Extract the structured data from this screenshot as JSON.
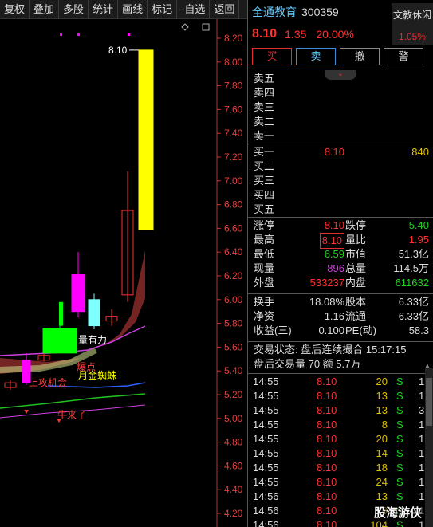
{
  "toolbar": {
    "items": [
      "复权",
      "叠加",
      "多股",
      "统计",
      "画线",
      "标记",
      "-自选",
      "返回"
    ]
  },
  "chart": {
    "axis_ticks": [
      "8.20",
      "8.00",
      "7.80",
      "7.60",
      "7.40",
      "7.20",
      "7.00",
      "6.80",
      "6.60",
      "6.40",
      "6.20",
      "6.00",
      "5.80",
      "5.60",
      "5.40",
      "5.20",
      "5.00",
      "4.80",
      "4.60",
      "4.40",
      "4.20"
    ],
    "price_label": "8.10",
    "annotations": [
      "量有力",
      "爆点",
      "月金蜘蛛",
      "上攻机会",
      "牛来了"
    ],
    "colors": {
      "up_yellow": "#ffff00",
      "magenta": "#ff00ff",
      "green": "#00ff00",
      "cyan": "#80ffff",
      "red": "#ff3030"
    },
    "icons": [
      "diamond-icon",
      "square-icon"
    ]
  },
  "header": {
    "name": "全通教育",
    "code": "300359",
    "status": "文教休闲",
    "status_pct": "1.05%"
  },
  "quote": {
    "price": "8.10",
    "change": "1.35",
    "pct": "20.00%"
  },
  "buttons": [
    "买",
    "卖",
    "撤",
    "警"
  ],
  "asks": [
    "卖五",
    "卖四",
    "卖三",
    "卖二",
    "卖一"
  ],
  "bids": [
    {
      "label": "买一",
      "price": "8.10",
      "vol": "840"
    },
    {
      "label": "买二",
      "price": "",
      "vol": ""
    },
    {
      "label": "买三",
      "price": "",
      "vol": ""
    },
    {
      "label": "买四",
      "price": "",
      "vol": ""
    },
    {
      "label": "买五",
      "price": "",
      "vol": ""
    }
  ],
  "stats1": [
    {
      "l1": "涨停",
      "v1": "8.10",
      "l2": "跌停",
      "v2": "5.40"
    },
    {
      "l1": "最高",
      "v1": "8.10",
      "l2": "量比",
      "v2": "1.95"
    },
    {
      "l1": "最低",
      "v1": "6.59",
      "l2": "市值",
      "v2": "51.3亿"
    },
    {
      "l1": "现量",
      "v1": "896",
      "l2": "总量",
      "v2": "114.5万"
    },
    {
      "l1": "外盘",
      "v1": "533237",
      "l2": "内盘",
      "v2": "611632"
    }
  ],
  "stats2": [
    {
      "l1": "换手",
      "v1": "18.08%",
      "l2": "股本",
      "v2": "6.33亿"
    },
    {
      "l1": "净资",
      "v1": "1.16",
      "l2": "流通",
      "v2": "6.33亿"
    },
    {
      "l1": "收益(三)",
      "v1": "0.100",
      "l2": "PE(动)",
      "v2": "58.3"
    }
  ],
  "trade_status": "交易状态: 盘后连续撮合 15:17:15",
  "after_hours": "盘后交易量 70 额 5.7万",
  "ticks": [
    {
      "t": "14:55",
      "p": "8.10",
      "q": "20",
      "s": "S",
      "n": "1"
    },
    {
      "t": "14:55",
      "p": "8.10",
      "q": "13",
      "s": "S",
      "n": "1"
    },
    {
      "t": "14:55",
      "p": "8.10",
      "q": "13",
      "s": "S",
      "n": "3"
    },
    {
      "t": "14:55",
      "p": "8.10",
      "q": "8",
      "s": "S",
      "n": "1"
    },
    {
      "t": "14:55",
      "p": "8.10",
      "q": "20",
      "s": "S",
      "n": "1"
    },
    {
      "t": "14:55",
      "p": "8.10",
      "q": "14",
      "s": "S",
      "n": "1"
    },
    {
      "t": "14:55",
      "p": "8.10",
      "q": "18",
      "s": "S",
      "n": "1"
    },
    {
      "t": "14:55",
      "p": "8.10",
      "q": "24",
      "s": "S",
      "n": "1"
    },
    {
      "t": "14:56",
      "p": "8.10",
      "q": "13",
      "s": "S",
      "n": "1"
    },
    {
      "t": "14:56",
      "p": "8.10",
      "q": "10",
      "s": "S",
      "n": "1"
    },
    {
      "t": "14:56",
      "p": "8.10",
      "q": "104",
      "s": "S",
      "n": "1"
    }
  ],
  "watermark": "股海游侠"
}
